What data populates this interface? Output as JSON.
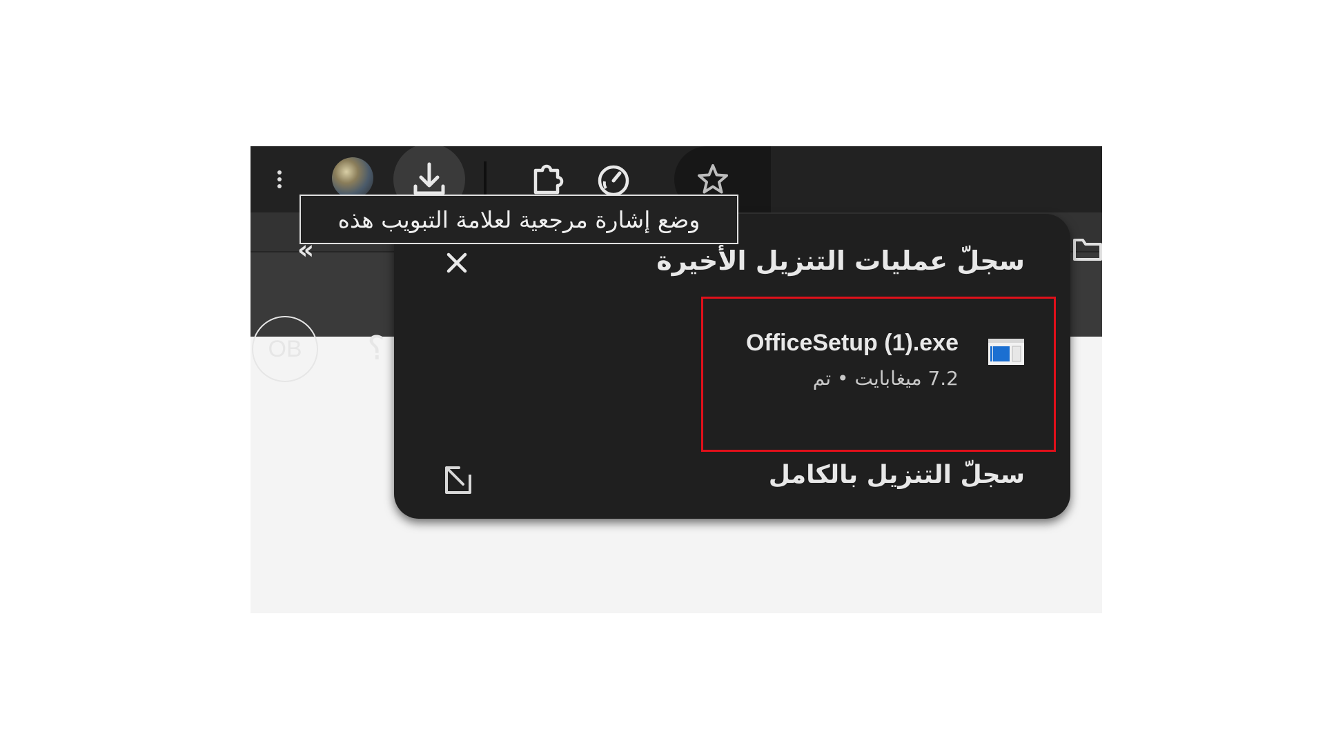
{
  "toolbar": {
    "icons": [
      "more-vert-icon",
      "profile-avatar",
      "download-icon",
      "extensions-puzzle-icon",
      "performance-gauge-icon",
      "bookmark-star-icon"
    ]
  },
  "tooltip": {
    "text": "وضع إشارة مرجعية لعلامة التبويب هذه"
  },
  "bookmarks_bar": {
    "overflow_icon": "chevrons-icon",
    "folder_icon": "folder-icon"
  },
  "page": {
    "avatar_initials": "OB",
    "help_glyph": "؟"
  },
  "downloads_panel": {
    "title": "سجلّ عمليات التنزيل الأخيرة",
    "items": [
      {
        "file_name": "OfficeSetup (1).exe",
        "status": "7.2 ميغابايت • تم",
        "icon": "installer-file-icon"
      }
    ],
    "full_history_label": "سجلّ التنزيل بالكامل",
    "close_icon": "close-icon",
    "open_icon": "open-in-new-icon"
  },
  "colors": {
    "highlight": "#e0101a",
    "panel_bg": "#1f1f1f",
    "toolbar_bg": "#222222"
  }
}
